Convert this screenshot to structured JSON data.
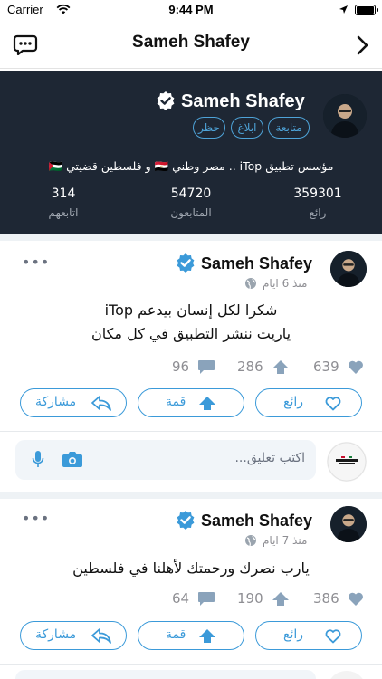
{
  "status_bar": {
    "carrier": "Carrier",
    "time": "9:44 PM"
  },
  "nav": {
    "title": "Sameh Shafey"
  },
  "profile": {
    "name": "Sameh Shafey",
    "buttons": {
      "follow": "متابعة",
      "report": "ابلاغ",
      "block": "حظر"
    },
    "bio": "مؤسس تطبيق iTop .. مصر وطني 🇪🇬 و فلسطين قضيتي 🇵🇸",
    "stats": [
      {
        "value": "359301",
        "label": "رائع"
      },
      {
        "value": "54720",
        "label": "المتابعون"
      },
      {
        "value": "314",
        "label": "اتابعهم"
      }
    ]
  },
  "posts": [
    {
      "author": "Sameh Shafey",
      "time": "منذ 6 ايام",
      "lines": [
        "شكرا لكل إنسان بيدعم iTop",
        "ياريت ننشر التطبيق في كل مكان"
      ],
      "likes": "639",
      "upvotes": "286",
      "comments": "96",
      "actions": {
        "like": "رائع",
        "top": "قمة",
        "share": "مشاركة"
      },
      "comment_placeholder": "اكتب تعليق..."
    },
    {
      "author": "Sameh Shafey",
      "time": "منذ 7 ايام",
      "lines": [
        "يارب نصرك ورحمتك لأهلنا في فلسطين"
      ],
      "likes": "386",
      "upvotes": "190",
      "comments": "64",
      "actions": {
        "like": "رائع",
        "top": "قمة",
        "share": "مشاركة"
      }
    }
  ],
  "colors": {
    "accent": "#3b9ad9",
    "header_bg": "#1e2734",
    "muted": "#8e8e93",
    "divider": "#eef2f5"
  }
}
